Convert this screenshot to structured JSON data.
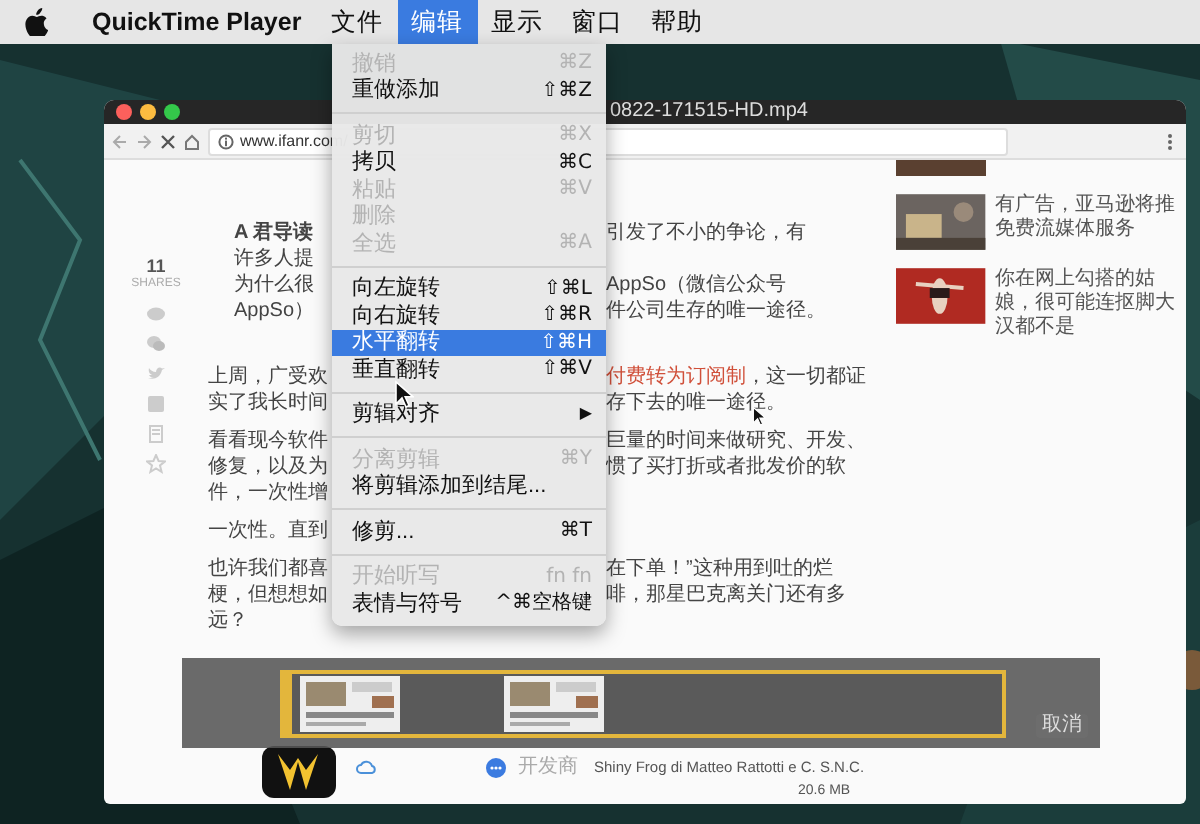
{
  "menubar": {
    "app_name": "QuickTime Player",
    "menus": [
      {
        "label": "文件",
        "selected": false
      },
      {
        "label": "编辑",
        "selected": true
      },
      {
        "label": "显示",
        "selected": false
      },
      {
        "label": "窗口",
        "selected": false
      },
      {
        "label": "帮助",
        "selected": false
      }
    ]
  },
  "edit_menu": {
    "items": [
      {
        "kind": "item",
        "label": "撤销",
        "shortcut": "⌘Z",
        "disabled": true,
        "selected": false
      },
      {
        "kind": "item",
        "label": "重做添加",
        "shortcut": "⇧⌘Z",
        "disabled": false,
        "selected": false
      },
      {
        "kind": "separator"
      },
      {
        "kind": "item",
        "label": "剪切",
        "shortcut": "⌘X",
        "disabled": true,
        "selected": false
      },
      {
        "kind": "item",
        "label": "拷贝",
        "shortcut": "⌘C",
        "disabled": false,
        "selected": false
      },
      {
        "kind": "item",
        "label": "粘贴",
        "shortcut": "⌘V",
        "disabled": true,
        "selected": false
      },
      {
        "kind": "item",
        "label": "删除",
        "disabled": true,
        "selected": false
      },
      {
        "kind": "item",
        "label": "全选",
        "shortcut": "⌘A",
        "disabled": true,
        "selected": false
      },
      {
        "kind": "separator"
      },
      {
        "kind": "item",
        "label": "向左旋转",
        "shortcut": "⇧⌘L",
        "disabled": false,
        "selected": false
      },
      {
        "kind": "item",
        "label": "向右旋转",
        "shortcut": "⇧⌘R",
        "disabled": false,
        "selected": false
      },
      {
        "kind": "item",
        "label": "水平翻转",
        "shortcut": "⇧⌘H",
        "disabled": false,
        "selected": true
      },
      {
        "kind": "item",
        "label": "垂直翻转",
        "shortcut": "⇧⌘V",
        "disabled": false,
        "selected": false
      },
      {
        "kind": "separator"
      },
      {
        "kind": "submenu",
        "label": "剪辑对齐",
        "arrow": "▶",
        "disabled": false,
        "selected": false
      },
      {
        "kind": "separator"
      },
      {
        "kind": "item",
        "label": "分离剪辑",
        "shortcut": "⌘Y",
        "disabled": true,
        "selected": false
      },
      {
        "kind": "item",
        "label": "将剪辑添加到结尾...",
        "disabled": false,
        "selected": false
      },
      {
        "kind": "separator"
      },
      {
        "kind": "item",
        "label": "修剪...",
        "shortcut": "⌘T",
        "disabled": false,
        "selected": false
      },
      {
        "kind": "separator"
      },
      {
        "kind": "item",
        "label": "开始听写",
        "shortcut": "fn fn",
        "disabled": true,
        "selected": false
      },
      {
        "kind": "item",
        "label": "表情与符号",
        "shortcut": "^⌘空格键",
        "disabled": false,
        "selected": false
      }
    ]
  },
  "window": {
    "title": "0822-171515-HD.mp4"
  },
  "browser": {
    "url": "www.ifanr.com/",
    "share_count": "11",
    "share_label": "SHARES",
    "quote": [
      {
        "left": "**A 君导读**",
        "right": "引发了不小的争论，有"
      },
      {
        "left": "许多人提"
      },
      {
        "left": "为什么很",
        "right": "AppSo（微信公众号"
      },
      {
        "left": "AppSo）",
        "right": "件公司生存的唯一途径。"
      }
    ],
    "paragraphs": [
      {
        "lines": [
          {
            "left": "上周，广受欢",
            "link": "付费转为订阅制",
            "right": "，这一切都证"
          },
          {
            "left": "实了我长时间",
            "right": "存下去的唯一途径。"
          }
        ]
      },
      {
        "lines": [
          {
            "left": "看看现今软件",
            "right": "巨量的时间来做研究、开发、"
          },
          {
            "left": "修复，以及为",
            "right": "惯了买打折或者批发价的软"
          },
          {
            "left": "件，一次性增"
          }
        ]
      },
      {
        "lines": [
          {
            "left": "一次性。直到"
          }
        ]
      },
      {
        "lines": [
          {
            "left": "也许我们都喜",
            "right": "在下单！”这种用到吐的烂"
          },
          {
            "left": "梗，但想想如",
            "right": "啡，那星巴克离关门还有多"
          },
          {
            "left": "远？"
          }
        ]
      }
    ],
    "related": [
      {
        "kind": "picture"
      },
      {
        "kind": "picture",
        "title": "有广告，亚马逊将推免费流媒体服务"
      },
      {
        "kind": "picture",
        "title": "你在网上勾搭的姑娘，很可能连抠脚大汉都不是"
      }
    ],
    "app_info": {
      "developer_label": "开发商",
      "developer": "Shiny Frog di Matteo Rattotti e C. S.N.C.",
      "size": "20.6 MB"
    }
  },
  "trim_bar": {
    "cancel": "取消"
  }
}
